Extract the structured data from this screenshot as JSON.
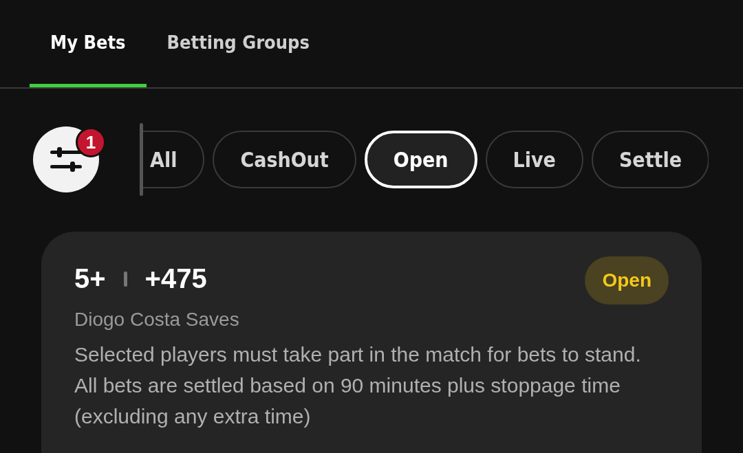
{
  "tabs": [
    {
      "label": "My Bets",
      "selected": true
    },
    {
      "label": "Betting Groups",
      "selected": false
    }
  ],
  "filter_button": {
    "badge": "1"
  },
  "chips": [
    {
      "label": "All",
      "selected": false
    },
    {
      "label": "CashOut",
      "selected": false
    },
    {
      "label": "Open",
      "selected": true
    },
    {
      "label": "Live",
      "selected": false
    },
    {
      "label": "Settle",
      "selected": false
    }
  ],
  "bet_card": {
    "selection": "5+",
    "odds": "+475",
    "status": "Open",
    "market": "Diogo Costa Saves",
    "note": "Selected players must take part in the match for bets to stand. All bets are settled based on 90 minutes plus stoppage time (excluding any extra time)"
  }
}
